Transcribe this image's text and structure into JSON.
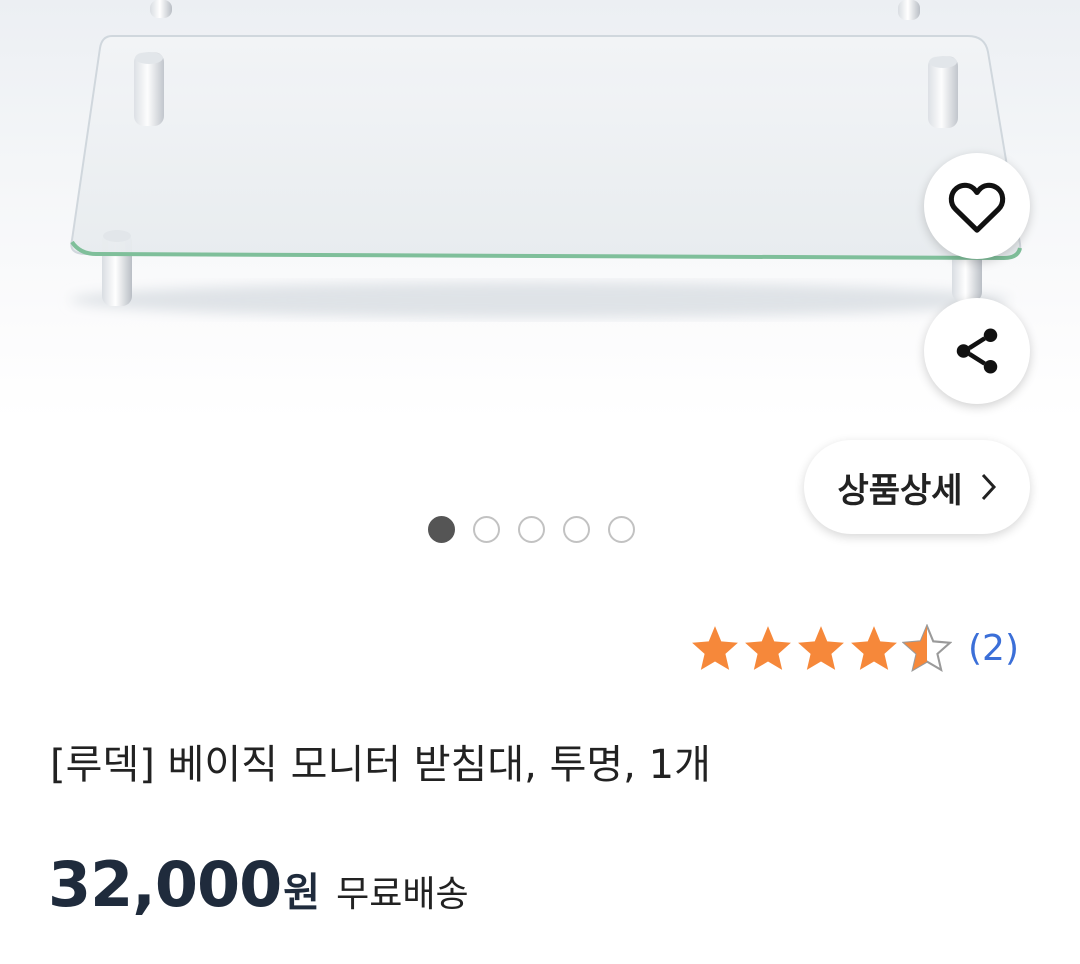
{
  "product": {
    "title": "[루덱] 베이직 모니터 받침대, 투명, 1개",
    "price": "32,000",
    "currency": "원",
    "shipping": "무료배송",
    "rating": 4.5,
    "review_count": "(2)"
  },
  "actions": {
    "like_icon": "heart-icon",
    "share_icon": "share-icon",
    "detail_label": "상품상세"
  },
  "gallery": {
    "total_images": 5,
    "current_index": 1
  },
  "colors": {
    "star": "#f6883a",
    "link": "#3b6fd8",
    "price": "#1f2b3c"
  }
}
